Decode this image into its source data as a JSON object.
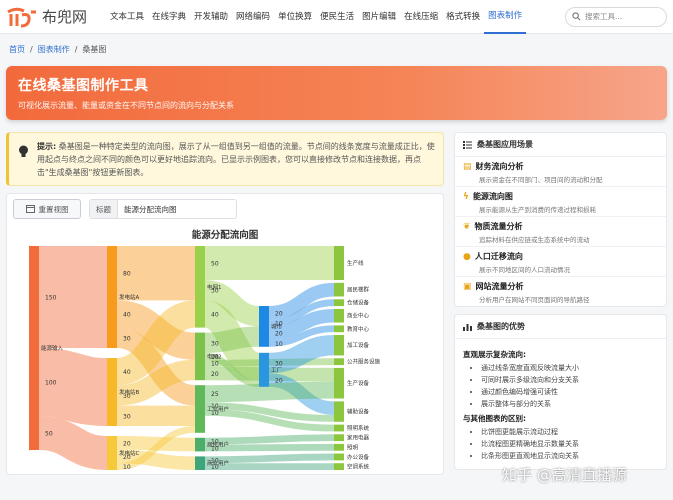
{
  "brand": {
    "name": "布兜网"
  },
  "nav": {
    "items": [
      "文本工具",
      "在线字典",
      "开发辅助",
      "网络编码",
      "单位换算",
      "便民生活",
      "图片编辑",
      "在线压缩",
      "格式转换",
      "图表制作"
    ],
    "active": "图表制作",
    "search_placeholder": "搜索工具..."
  },
  "breadcrumb": {
    "home": "首页",
    "category": "图表制作",
    "current": "桑基图"
  },
  "hero": {
    "title": "在线桑基图制作工具",
    "subtitle": "可视化展示流量、能量或资金在不同节点间的流向与分配关系"
  },
  "tip": {
    "label": "提示:",
    "text": "桑基图是一种特定类型的流向图，展示了从一组值到另一组值的流量。节点间的线条宽度与流量成正比，使用起点与终点之间不同的颜色可以更好地追踪流向。已显示示例图表，您可以直接修改节点和连接数据，再点击\"生成桑基图\"按钮更新图表。"
  },
  "toolbar": {
    "reset_label": "重置视图",
    "title_label": "标题",
    "title_value": "能源分配流向图"
  },
  "chart_data": {
    "type": "sankey",
    "title": "能源分配流向图",
    "nodes": [
      {
        "name": "能源输入",
        "color": "#f26b3a"
      },
      {
        "name": "发电站A",
        "color": "#f89a1c"
      },
      {
        "name": "发电站B",
        "color": "#f7b928"
      },
      {
        "name": "发电站C",
        "color": "#f6c83a"
      },
      {
        "name": "电网1",
        "color": "#9bd04a"
      },
      {
        "name": "电网2",
        "color": "#7cc24a"
      },
      {
        "name": "工业用户",
        "color": "#5fb85a"
      },
      {
        "name": "居民用户",
        "color": "#4cae6a"
      },
      {
        "name": "商业用户",
        "color": "#3fa57a"
      },
      {
        "name": "城市",
        "color": "#1e88e5"
      },
      {
        "name": "工厂",
        "color": "#2b96e0"
      },
      {
        "name": "生产线",
        "color": "#8cc63f"
      },
      {
        "name": "居民楼群",
        "color": "#8cc63f"
      },
      {
        "name": "仓储设备",
        "color": "#8cc63f"
      },
      {
        "name": "商业中心",
        "color": "#8cc63f"
      },
      {
        "name": "教育中心",
        "color": "#8cc63f"
      },
      {
        "name": "加工设备",
        "color": "#8cc63f"
      },
      {
        "name": "公共服务设施",
        "color": "#8cc63f"
      },
      {
        "name": "生产设备",
        "color": "#8cc63f"
      },
      {
        "name": "辅助设备",
        "color": "#8cc63f"
      },
      {
        "name": "照明系统",
        "color": "#8cc63f"
      },
      {
        "name": "家用电器",
        "color": "#8cc63f"
      },
      {
        "name": "照明",
        "color": "#8cc63f"
      },
      {
        "name": "办公设备",
        "color": "#8cc63f"
      },
      {
        "name": "空调系统",
        "color": "#8cc63f"
      }
    ],
    "links": [
      {
        "source": "能源输入",
        "target": "发电站A",
        "value": 150
      },
      {
        "source": "能源输入",
        "target": "发电站B",
        "value": 100
      },
      {
        "source": "能源输入",
        "target": "发电站C",
        "value": 50
      },
      {
        "source": "发电站A",
        "target": "电网1",
        "value": 80
      },
      {
        "source": "发电站A",
        "target": "电网2",
        "value": 40
      },
      {
        "source": "发电站A",
        "target": "工业用户",
        "value": 30
      },
      {
        "source": "发电站B",
        "target": "电网1",
        "value": 40
      },
      {
        "source": "发电站B",
        "target": "电网2",
        "value": 30
      },
      {
        "source": "发电站B",
        "target": "工业用户",
        "value": 30
      },
      {
        "source": "发电站C",
        "target": "居民用户",
        "value": 20
      },
      {
        "source": "发电站C",
        "target": "商业用户",
        "value": 20
      },
      {
        "source": "发电站C",
        "target": "工业用户",
        "value": 10
      },
      {
        "source": "电网1",
        "target": "生产线",
        "value": 50
      },
      {
        "source": "电网1",
        "target": "城市",
        "value": 30
      },
      {
        "source": "电网1",
        "target": "工厂",
        "value": 40
      },
      {
        "source": "电网2",
        "target": "城市",
        "value": 30
      },
      {
        "source": "电网2",
        "target": "工厂",
        "value": 10
      },
      {
        "source": "电网2",
        "target": "公共服务设施",
        "value": 10
      },
      {
        "source": "电网2",
        "target": "生产设备",
        "value": 20
      },
      {
        "source": "城市",
        "target": "居民楼群",
        "value": 20
      },
      {
        "source": "城市",
        "target": "仓储设备",
        "value": 10
      },
      {
        "source": "城市",
        "target": "商业中心",
        "value": 20
      },
      {
        "source": "城市",
        "target": "教育中心",
        "value": 10
      },
      {
        "source": "工厂",
        "target": "加工设备",
        "value": 30
      },
      {
        "source": "工厂",
        "target": "辅助设备",
        "value": 20
      },
      {
        "source": "工业用户",
        "target": "生产设备",
        "value": 25
      },
      {
        "source": "工业用户",
        "target": "辅助设备",
        "value": 10
      },
      {
        "source": "工业用户",
        "target": "照明系统",
        "value": 10
      },
      {
        "source": "居民用户",
        "target": "家用电器",
        "value": 10
      },
      {
        "source": "居民用户",
        "target": "照明",
        "value": 10
      },
      {
        "source": "商业用户",
        "target": "办公设备",
        "value": 10
      },
      {
        "source": "商业用户",
        "target": "空调系统",
        "value": 10
      }
    ]
  },
  "apps": {
    "title": "桑基图应用场景",
    "items": [
      {
        "title": "财务流向分析",
        "desc": "展示资金在不同部门、项目间的流动和分配"
      },
      {
        "title": "能源流向图",
        "desc": "展示能源从生产到消费的传递过程和损耗"
      },
      {
        "title": "物质流量分析",
        "desc": "追踪材料在供应链或生态系统中的流动"
      },
      {
        "title": "人口迁移流向",
        "desc": "展示不同地区间的人口流动情况"
      },
      {
        "title": "网站流量分析",
        "desc": "分析用户在网站不同页面间的导航路径"
      }
    ]
  },
  "advantages": {
    "title": "桑基图的优势",
    "section1_title": "直观展示复杂流向:",
    "section1_items": [
      "通过线条宽度直观反映流量大小",
      "可同时展示多级流向和分支关系",
      "通过颜色编码增强可读性",
      "展示整体与部分的关系"
    ],
    "section2_title": "与其他图表的区别:",
    "section2_items": [
      "比饼图更能展示流动过程",
      "比流程图更精确地显示数量关系",
      "比条形图更直观地显示流向关系"
    ]
  },
  "watermark": "知乎 @高清直播源"
}
